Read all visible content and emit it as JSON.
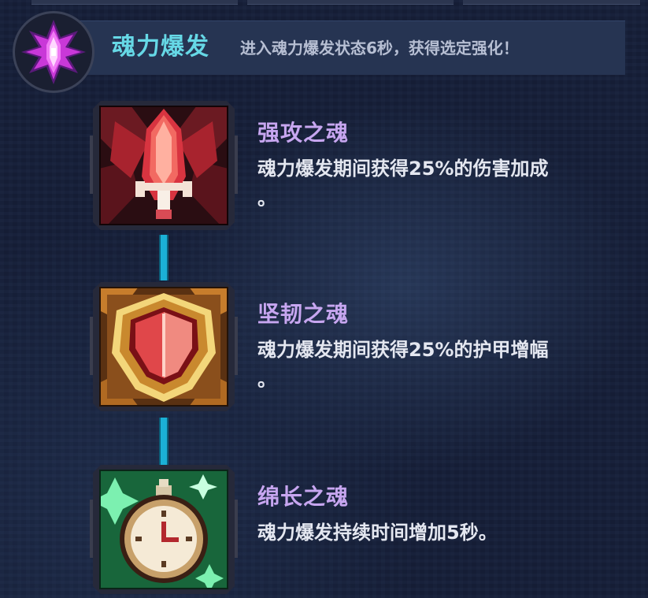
{
  "header": {
    "title": "魂力爆发",
    "description": "进入魂力爆发状态6秒，获得选定强化！",
    "emblem_icon": "purple-soul-crystal-icon"
  },
  "skills": [
    {
      "name": "强攻之魂",
      "description": "魂力爆发期间获得25%的伤害加成",
      "description_tail": "。",
      "icon": "red-sword-soul-icon",
      "accent_color": "#c8283a"
    },
    {
      "name": "坚韧之魂",
      "description": "魂力爆发期间获得25%的护甲增幅",
      "description_tail": "。",
      "icon": "orange-shield-soul-icon",
      "accent_color": "#d9862a"
    },
    {
      "name": "绵长之魂",
      "description": "魂力爆发持续时间增加5秒。",
      "description_tail": "",
      "icon": "green-stopwatch-soul-icon",
      "accent_color": "#2fbf6a"
    }
  ],
  "colors": {
    "title": "#66d8e6",
    "skill_name": "#c7a6f0",
    "skill_text": "#e4e7f0",
    "connector": "#1bb0d6"
  }
}
